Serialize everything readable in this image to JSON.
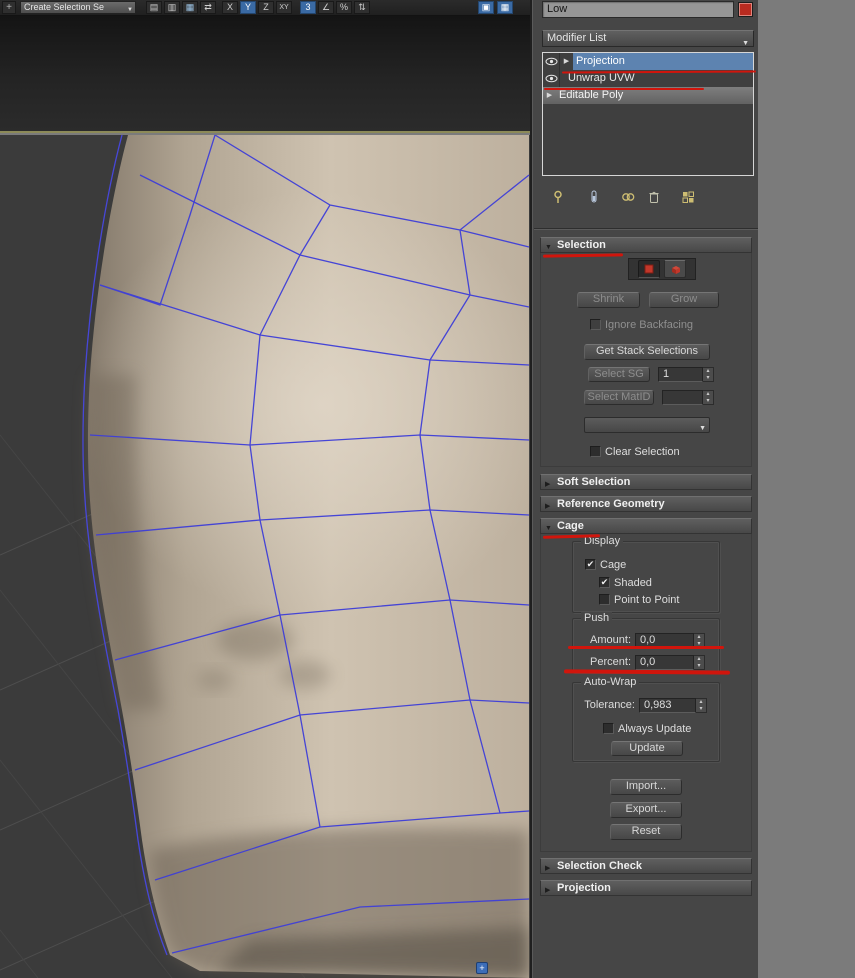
{
  "theme": {
    "annotation": "#d1150c",
    "selection-blue": "#5d83b0",
    "object-red": "#b92b20",
    "icon-yellow": "#cdbd72"
  },
  "glyphs": {
    "check": "✔",
    "dropdown": "▼",
    "expanded": "▼",
    "collapsed": "▶",
    "spin_up": "▴",
    "spin_down": "▾",
    "row_arrow": "▶"
  },
  "toolbar": {
    "pan_glyph": "+",
    "selection_set_label": "Create Selection Se",
    "icons": [
      {
        "name": "schematic-view-icon",
        "glyph": "▤"
      },
      {
        "name": "display-layers-icon",
        "glyph": "▥"
      },
      {
        "name": "curve-editor-icon",
        "glyph": "▦"
      },
      {
        "name": "mirror-icon",
        "glyph": "⇄"
      },
      {
        "name": "constraint-x-icon",
        "glyph": "X"
      },
      {
        "name": "constraint-y-icon",
        "glyph": "Y"
      },
      {
        "name": "constraint-z-icon",
        "glyph": "Z"
      },
      {
        "name": "constraint-xy-icon",
        "glyph": "XY"
      },
      {
        "name": "snap-3d-icon",
        "glyph": "3"
      },
      {
        "name": "angle-snap-icon",
        "glyph": "∠"
      },
      {
        "name": "percent-snap-icon",
        "glyph": "%"
      },
      {
        "name": "spinner-snap-icon",
        "glyph": "⇅"
      },
      {
        "name": "render-setup-icon",
        "glyph": "▣"
      },
      {
        "name": "render-frame-icon",
        "glyph": "▦"
      }
    ]
  },
  "object": {
    "name": "Low"
  },
  "modifier_panel": {
    "modifier_list_label": "Modifier List",
    "stack": [
      {
        "label": "Projection"
      },
      {
        "label": "Unwrap UVW"
      },
      {
        "label": "Editable Poly"
      }
    ],
    "tools": [
      "pin-stack",
      "show-end-result",
      "make-unique",
      "remove-modifier",
      "configure-modifier-sets"
    ]
  },
  "rollouts": {
    "selection": {
      "title": "Selection",
      "shrink": "Shrink",
      "grow": "Grow",
      "ignore_backfacing": "Ignore Backfacing",
      "get_stack_selections": "Get Stack Selections",
      "select_sg": "Select SG",
      "sg_value": "1",
      "select_matid": "Select MatID",
      "matid_value": "",
      "combo_value": "",
      "clear_selection": "Clear Selection"
    },
    "soft_selection": {
      "title": "Soft Selection"
    },
    "reference_geometry": {
      "title": "Reference Geometry"
    },
    "cage": {
      "title": "Cage",
      "display": {
        "title": "Display",
        "cage": "Cage",
        "shaded": "Shaded",
        "point_to_point": "Point to Point"
      },
      "push": {
        "title": "Push",
        "amount_label": "Amount:",
        "amount_value": "0,0",
        "percent_label": "Percent:",
        "percent_value": "0,0"
      },
      "auto_wrap": {
        "title": "Auto-Wrap",
        "tolerance_label": "Tolerance:",
        "tolerance_value": "0,983",
        "always_update": "Always Update",
        "update": "Update"
      },
      "import": "Import...",
      "export": "Export...",
      "reset": "Reset"
    },
    "selection_check": {
      "title": "Selection Check"
    },
    "projection": {
      "title": "Projection"
    }
  },
  "viewport": {
    "badge_glyph": "+"
  }
}
